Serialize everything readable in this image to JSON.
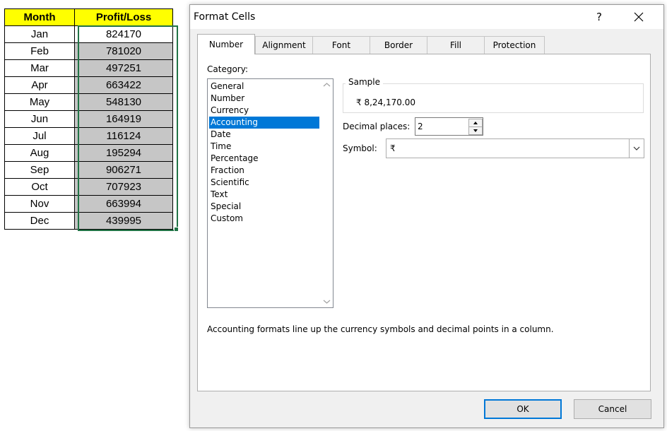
{
  "sheet": {
    "headers": [
      "Month",
      "Profit/Loss"
    ],
    "rows": [
      [
        "Jan",
        "824170"
      ],
      [
        "Feb",
        "781020"
      ],
      [
        "Mar",
        "497251"
      ],
      [
        "Apr",
        "663422"
      ],
      [
        "May",
        "548130"
      ],
      [
        "Jun",
        "164919"
      ],
      [
        "Jul",
        "116124"
      ],
      [
        "Aug",
        "195294"
      ],
      [
        "Sep",
        "906271"
      ],
      [
        "Oct",
        "707923"
      ],
      [
        "Nov",
        "663994"
      ],
      [
        "Dec",
        "439995"
      ]
    ],
    "header_fill": "#ffff00",
    "selection_color": "#217346"
  },
  "dialog": {
    "title": "Format Cells",
    "help": "?",
    "tabs": [
      "Number",
      "Alignment",
      "Font",
      "Border",
      "Fill",
      "Protection"
    ],
    "active_tab": "Number",
    "category_label": "Category:",
    "categories": [
      "General",
      "Number",
      "Currency",
      "Accounting",
      "Date",
      "Time",
      "Percentage",
      "Fraction",
      "Scientific",
      "Text",
      "Special",
      "Custom"
    ],
    "selected_category": "Accounting",
    "sample_label": "Sample",
    "sample_value": "₹ 8,24,170.00",
    "decimal_label": "Decimal places:",
    "decimal_value": "2",
    "symbol_label": "Symbol:",
    "symbol_value": "₹",
    "description": "Accounting formats line up the currency symbols and decimal points in a column.",
    "ok_label": "OK",
    "cancel_label": "Cancel",
    "accent": "#0078d7"
  }
}
